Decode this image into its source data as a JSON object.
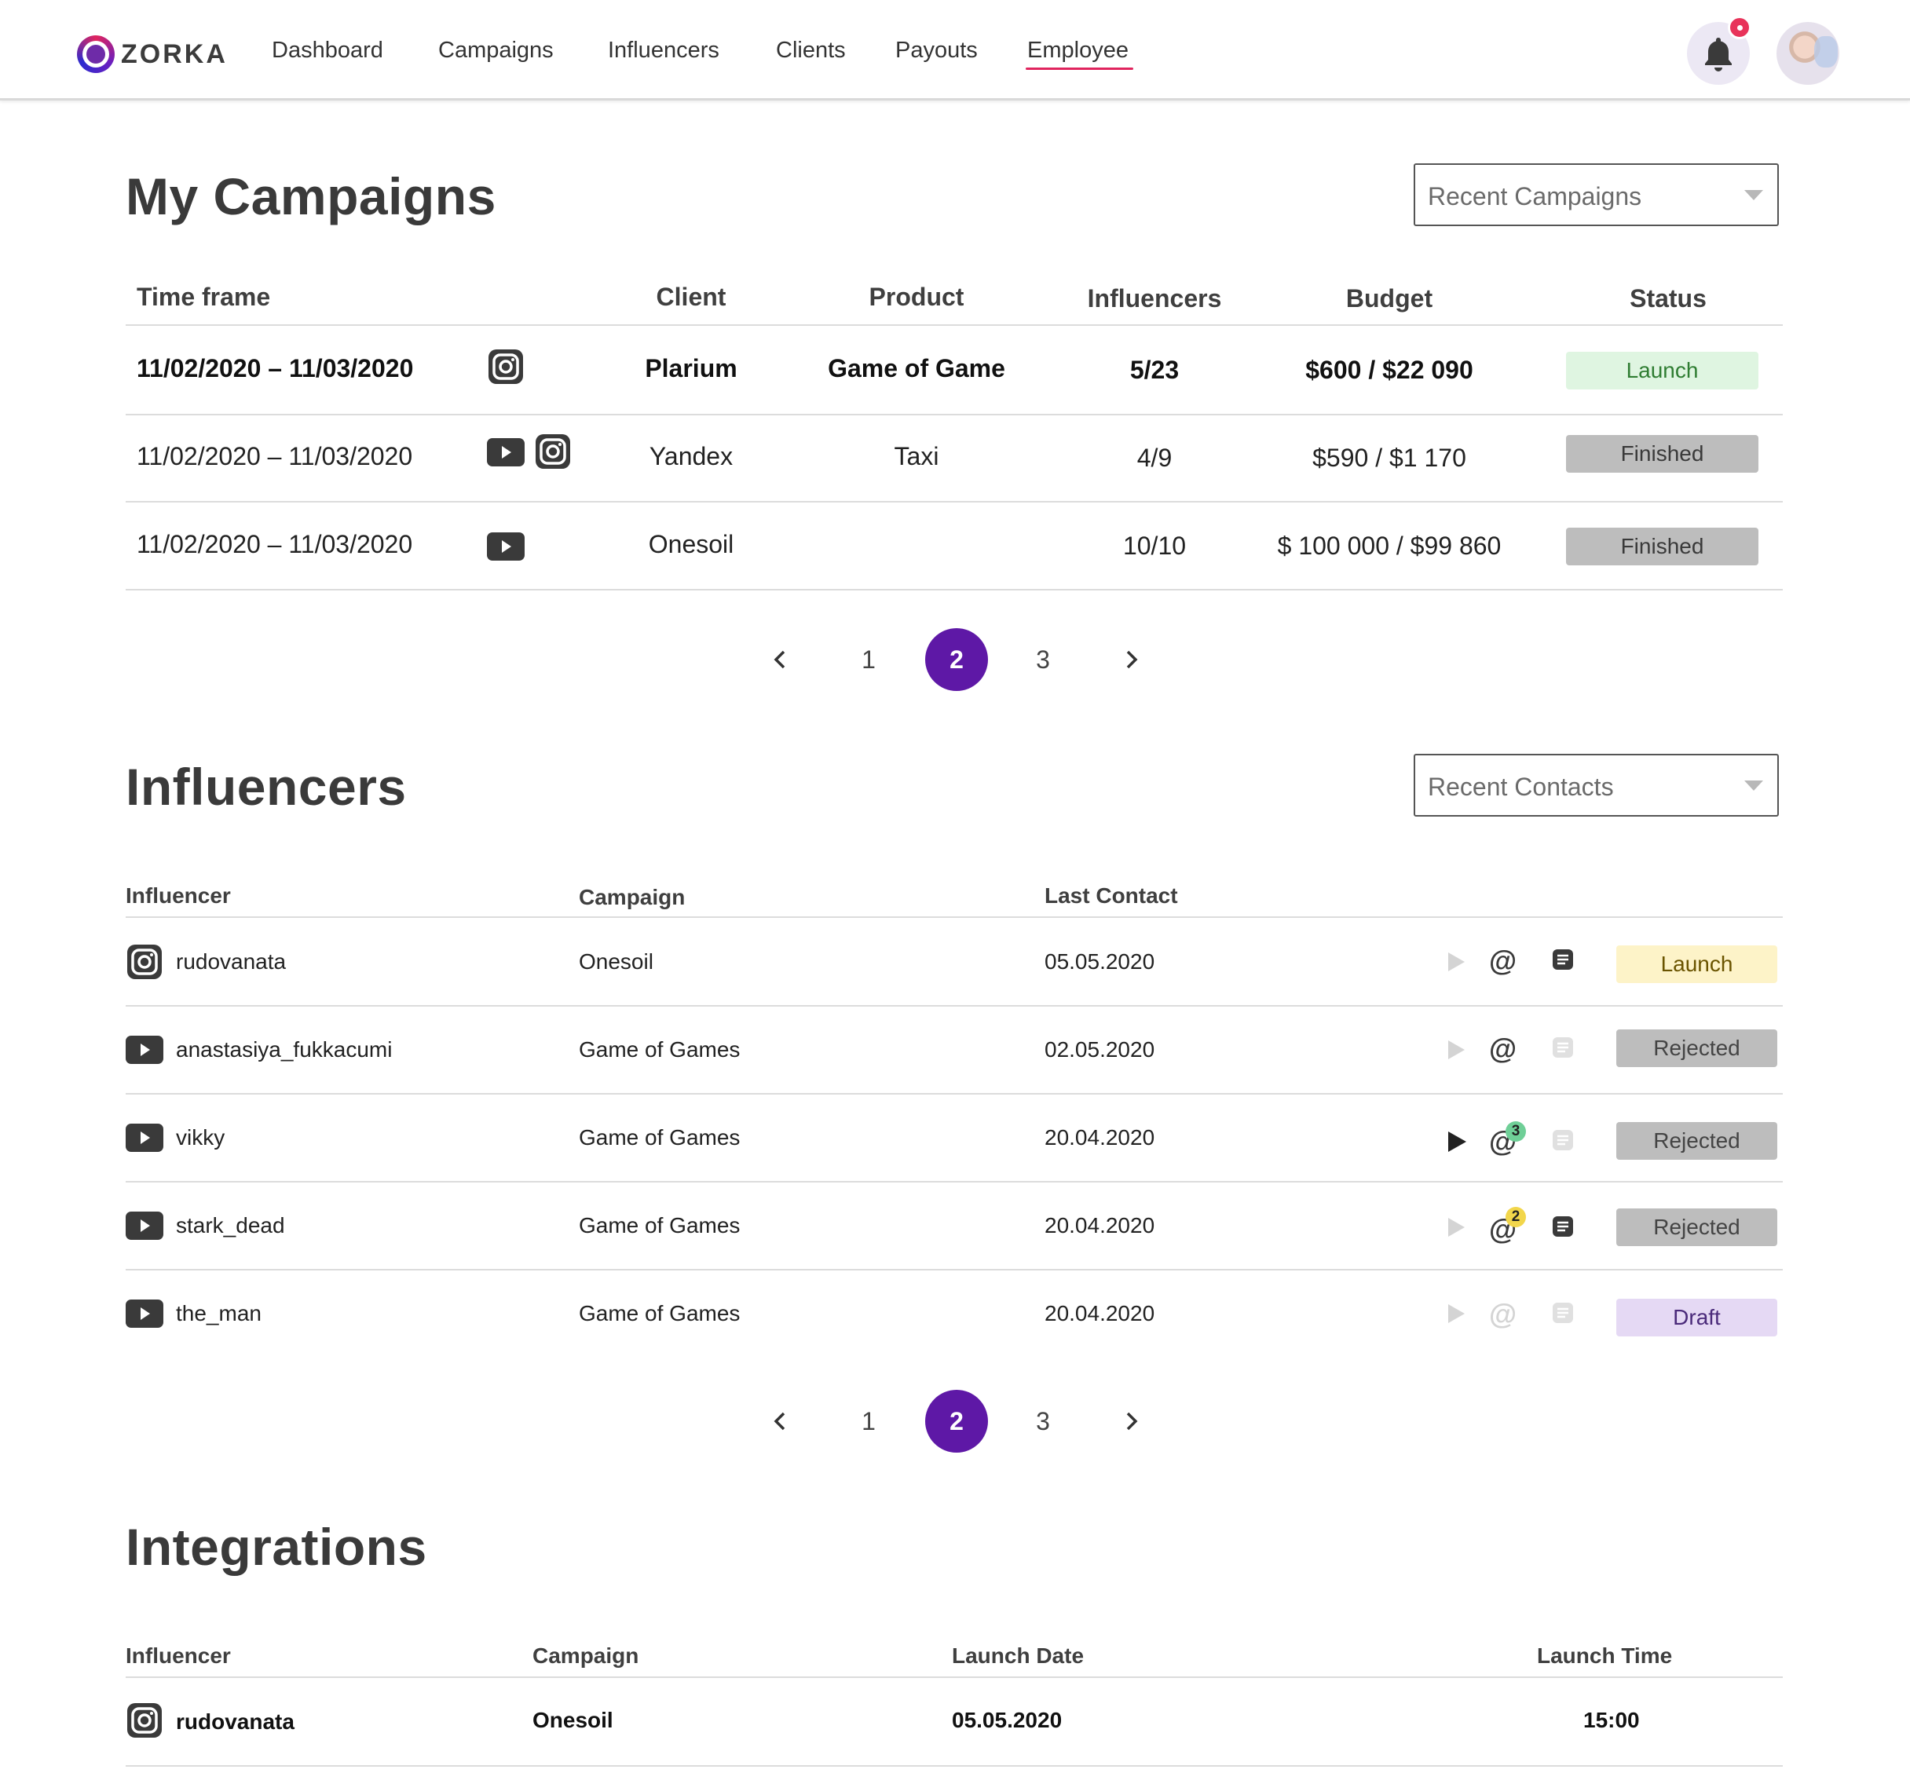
{
  "brand": {
    "name": "ZORKA"
  },
  "nav": {
    "items": [
      {
        "label": "Dashboard"
      },
      {
        "label": "Campaigns"
      },
      {
        "label": "Influencers"
      },
      {
        "label": "Clients"
      },
      {
        "label": "Payouts"
      },
      {
        "label": "Employee",
        "active": true
      }
    ]
  },
  "icons": {
    "instagram": "instagram-icon",
    "youtube": "youtube-icon",
    "notification": "bell-icon",
    "message": "message-icon",
    "mention": "at-icon",
    "play": "play-icon"
  },
  "campaigns": {
    "title": "My Campaigns",
    "dropdown": "Recent Campaigns",
    "headers": [
      "Time frame",
      "Client",
      "Product",
      "Influencers",
      "Budget",
      "Status"
    ],
    "rows": [
      {
        "time_frame": "11/02/2020 – 11/03/2020",
        "platforms": [
          "instagram"
        ],
        "client": "Plarium",
        "product": "Game of Game",
        "influencers": "5/23",
        "budget": "$600 / $22 090",
        "status": "Launch",
        "highlight": true
      },
      {
        "time_frame": "11/02/2020 – 11/03/2020",
        "platforms": [
          "youtube",
          "instagram"
        ],
        "client": "Yandex",
        "product": "Taxi",
        "influencers": "4/9",
        "budget": "$590 / $1 170",
        "status": "Finished"
      },
      {
        "time_frame": "11/02/2020 – 11/03/2020",
        "platforms": [
          "youtube"
        ],
        "client": "Onesoil",
        "product": "",
        "influencers": "10/10",
        "budget": "$ 100 000 / $99 860",
        "status": "Finished"
      }
    ],
    "pagination": {
      "pages": [
        "1",
        "2",
        "3"
      ],
      "current": "2"
    }
  },
  "influencers": {
    "title": "Influencers",
    "dropdown": "Recent Contacts",
    "headers": [
      "Influencer",
      "Campaign",
      "Last Contact"
    ],
    "rows": [
      {
        "platform": "instagram",
        "name": "rudovanata",
        "campaign": "Onesoil",
        "last_contact": "05.05.2020",
        "status": "Launch",
        "mentions": ""
      },
      {
        "platform": "youtube",
        "name": "anastasiya_fukkacumi",
        "campaign": "Game of Games",
        "last_contact": "02.05.2020",
        "status": "Rejected",
        "mentions": ""
      },
      {
        "platform": "youtube",
        "name": "vikky",
        "campaign": "Game of Games",
        "last_contact": "20.04.2020",
        "status": "Rejected",
        "mentions": "3"
      },
      {
        "platform": "youtube",
        "name": "stark_dead",
        "campaign": "Game of Games",
        "last_contact": "20.04.2020",
        "status": "Rejected",
        "mentions": "2"
      },
      {
        "platform": "youtube",
        "name": "the_man",
        "campaign": "Game of Games",
        "last_contact": "20.04.2020",
        "status": "Draft",
        "mentions": ""
      }
    ],
    "pagination": {
      "pages": [
        "1",
        "2",
        "3"
      ],
      "current": "2"
    }
  },
  "integrations": {
    "title": "Integrations",
    "headers": [
      "Influencer",
      "Campaign",
      "Launch Date",
      "Launch Time"
    ],
    "rows": [
      {
        "platform": "instagram",
        "name": "rudovanata",
        "campaign": "Onesoil",
        "launch_date": "05.05.2020",
        "launch_time": "15:00"
      }
    ]
  },
  "colors": {
    "accent": "#5e18a6",
    "nav_underline": "#e0245e",
    "notification_dot": "#e8335a",
    "launch_green": "#dff5e1",
    "launch_yellow": "#fdf3c8",
    "finished_gray": "#bdbdbd",
    "draft_purple": "#e5d9f4",
    "mention_green": "#6fcf97",
    "mention_yellow": "#f2d64b"
  }
}
